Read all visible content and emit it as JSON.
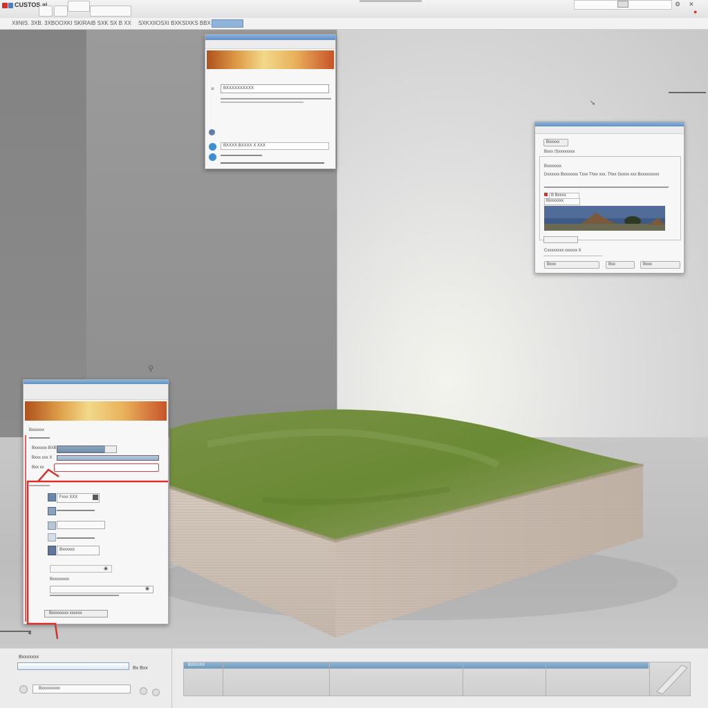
{
  "app": {
    "title": "CUSTOS ai",
    "toolbar_text": "XIINIS. 3XB. 3XBOOXKI SKIRAIB SXK SX B XX",
    "toolbar_text2": "SXKXIIOSXI BXKSIXKS BBX"
  },
  "window_top": {
    "field_value": "BXXXXXXXXXX",
    "row_text": "BXXXX BXXXX X  XXX"
  },
  "window_right": {
    "tab": "Bxxxxx",
    "heading": "Bxxx /Sxxxxxxxx",
    "section": "Bxxxxxxx",
    "para": "Dxxxxxx Bxxxxxxx Txxx Thxx xxx. Thxx Gxxxx xxx Bxxxxxxxxx",
    "field1": "B Bxxxx",
    "field2": "Bxxxxxxx",
    "caption": "Cxxxxxxxx xxxxxx X",
    "buttons": [
      "Bxxx",
      "Bxx",
      "Bxxx"
    ]
  },
  "window_left": {
    "label1": "Bxxxxxx",
    "row1_label": "Bxxxxxx BXB",
    "row2_label": "Bxxx xxx X",
    "row3_label": "Bxx xx",
    "field1": "Fxxx XXX",
    "field2": "Bxxxxxx",
    "section": "Bxxxxxxxx",
    "footer": "Bxxxxxxxx xxxxxx"
  },
  "bottom": {
    "label": "Bxxxxxxx",
    "zoom": "Bx Bxx",
    "select": "Bxxxxxxxxx",
    "timeline_head": "BXXXXX"
  },
  "colors": {
    "accent_red": "#d9302a",
    "title_blue": "#5f8fc4",
    "grass": "#6f8a3a",
    "slab": "#cfc3b8"
  }
}
